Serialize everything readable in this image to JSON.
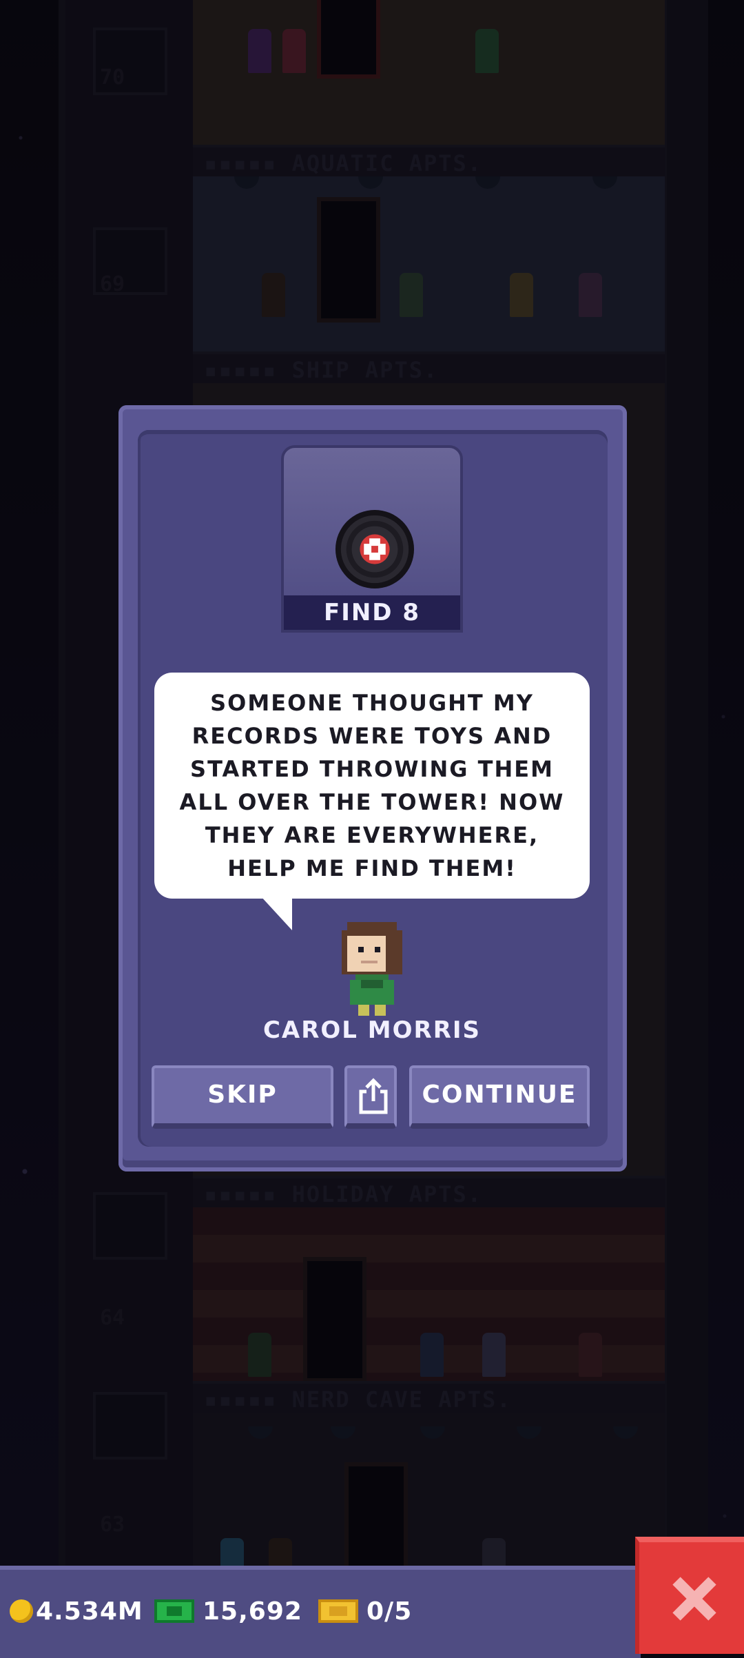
{
  "tower": {
    "floors": [
      {
        "name": "AQUATIC APTS.",
        "floor_number": "70"
      },
      {
        "name": "SHIP APTS.",
        "floor_number": "69"
      },
      {
        "name": "HOLIDAY APTS.",
        "floor_number": "64"
      },
      {
        "name": "NERD CAVE APTS.",
        "floor_number": "63"
      }
    ]
  },
  "dialog": {
    "item_icon": "vinyl-record-icon",
    "find_label": "FIND 8",
    "message": "SOMEONE THOUGHT MY\nRECORDS WERE TOYS AND\nSTARTED THROWING THEM\nALL OVER THE TOWER! NOW\nTHEY ARE EVERYWHERE,\nHELP ME FIND THEM!",
    "character_name": "CAROL MORRIS",
    "skip_label": "SKIP",
    "continue_label": "CONTINUE",
    "share_icon": "share-icon"
  },
  "bottom_bar": {
    "coins": "4.534M",
    "bux": "15,692",
    "tickets": "0/5",
    "close_icon": "close-icon"
  },
  "colors": {
    "dialog_bg": "#5a5693",
    "button_bg": "#6e6aa6",
    "close_red": "#e33a3a",
    "coin_gold": "#f4c21d",
    "bux_green": "#26b34a"
  }
}
